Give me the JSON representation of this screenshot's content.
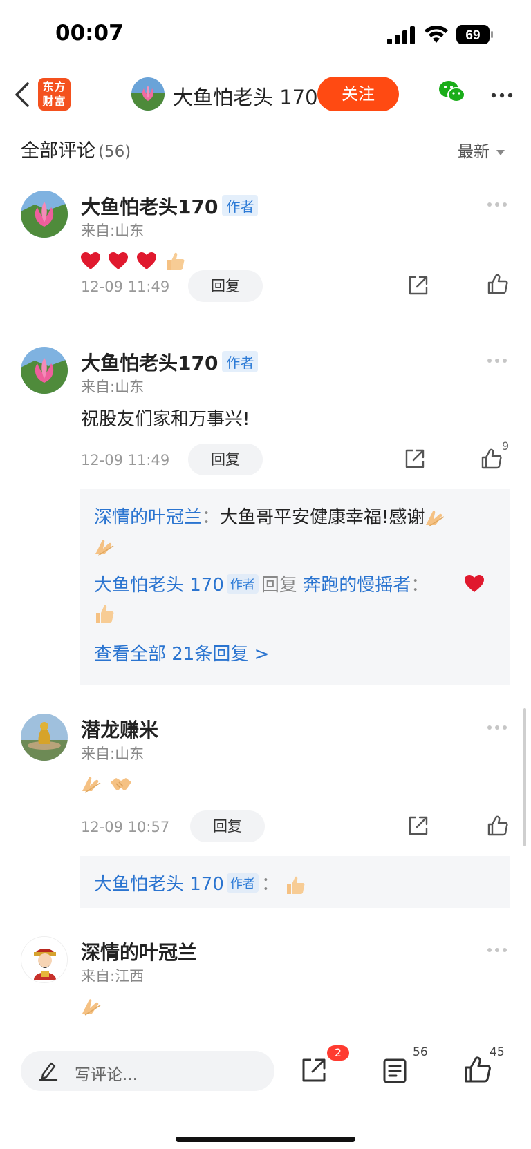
{
  "status_bar": {
    "time": "00:07",
    "battery": "69"
  },
  "nav": {
    "logo_line1": "东方",
    "logo_line2": "财富",
    "name": "大鱼怕老头 170",
    "follow_label": "关注"
  },
  "header": {
    "title": "全部评论",
    "count": "(56)",
    "sort_label": "最新"
  },
  "comments": [
    {
      "name": "大鱼怕老头170",
      "author_tag": "作者",
      "location": "来自:山东",
      "date": "12-09 11:49",
      "reply_label": "回复"
    },
    {
      "name": "大鱼怕老头170",
      "author_tag": "作者",
      "location": "来自:山东",
      "text": "祝股友们家和万事兴!",
      "date": "12-09 11:49",
      "reply_label": "回复",
      "like_count": "9",
      "replies": {
        "r1_user": "深情的叶冠兰",
        "r1_sep": "：",
        "r1_text": "大鱼哥平安健康幸福!感谢",
        "r2_user": "大鱼怕老头 170",
        "r2_tag": "作者",
        "r2_verb": "回复",
        "r2_target": "奔跑的慢摇者",
        "r2_sep": "：",
        "view_all": "查看全部 21条回复 >"
      }
    },
    {
      "name": "潜龙赚米",
      "location": "来自:山东",
      "date": "12-09 10:57",
      "reply_label": "回复",
      "replies": {
        "r1_user": "大鱼怕老头 170",
        "r1_tag": "作者",
        "r1_sep": "："
      }
    },
    {
      "name": "深情的叶冠兰",
      "location": "来自:江西"
    }
  ],
  "bottom": {
    "placeholder": "写评论...",
    "share_badge": "2",
    "comment_count": "56",
    "like_count": "45"
  },
  "colors": {
    "accent": "#ff4a12",
    "link": "#2a74d0",
    "author_tag_bg": "#e4effb"
  }
}
